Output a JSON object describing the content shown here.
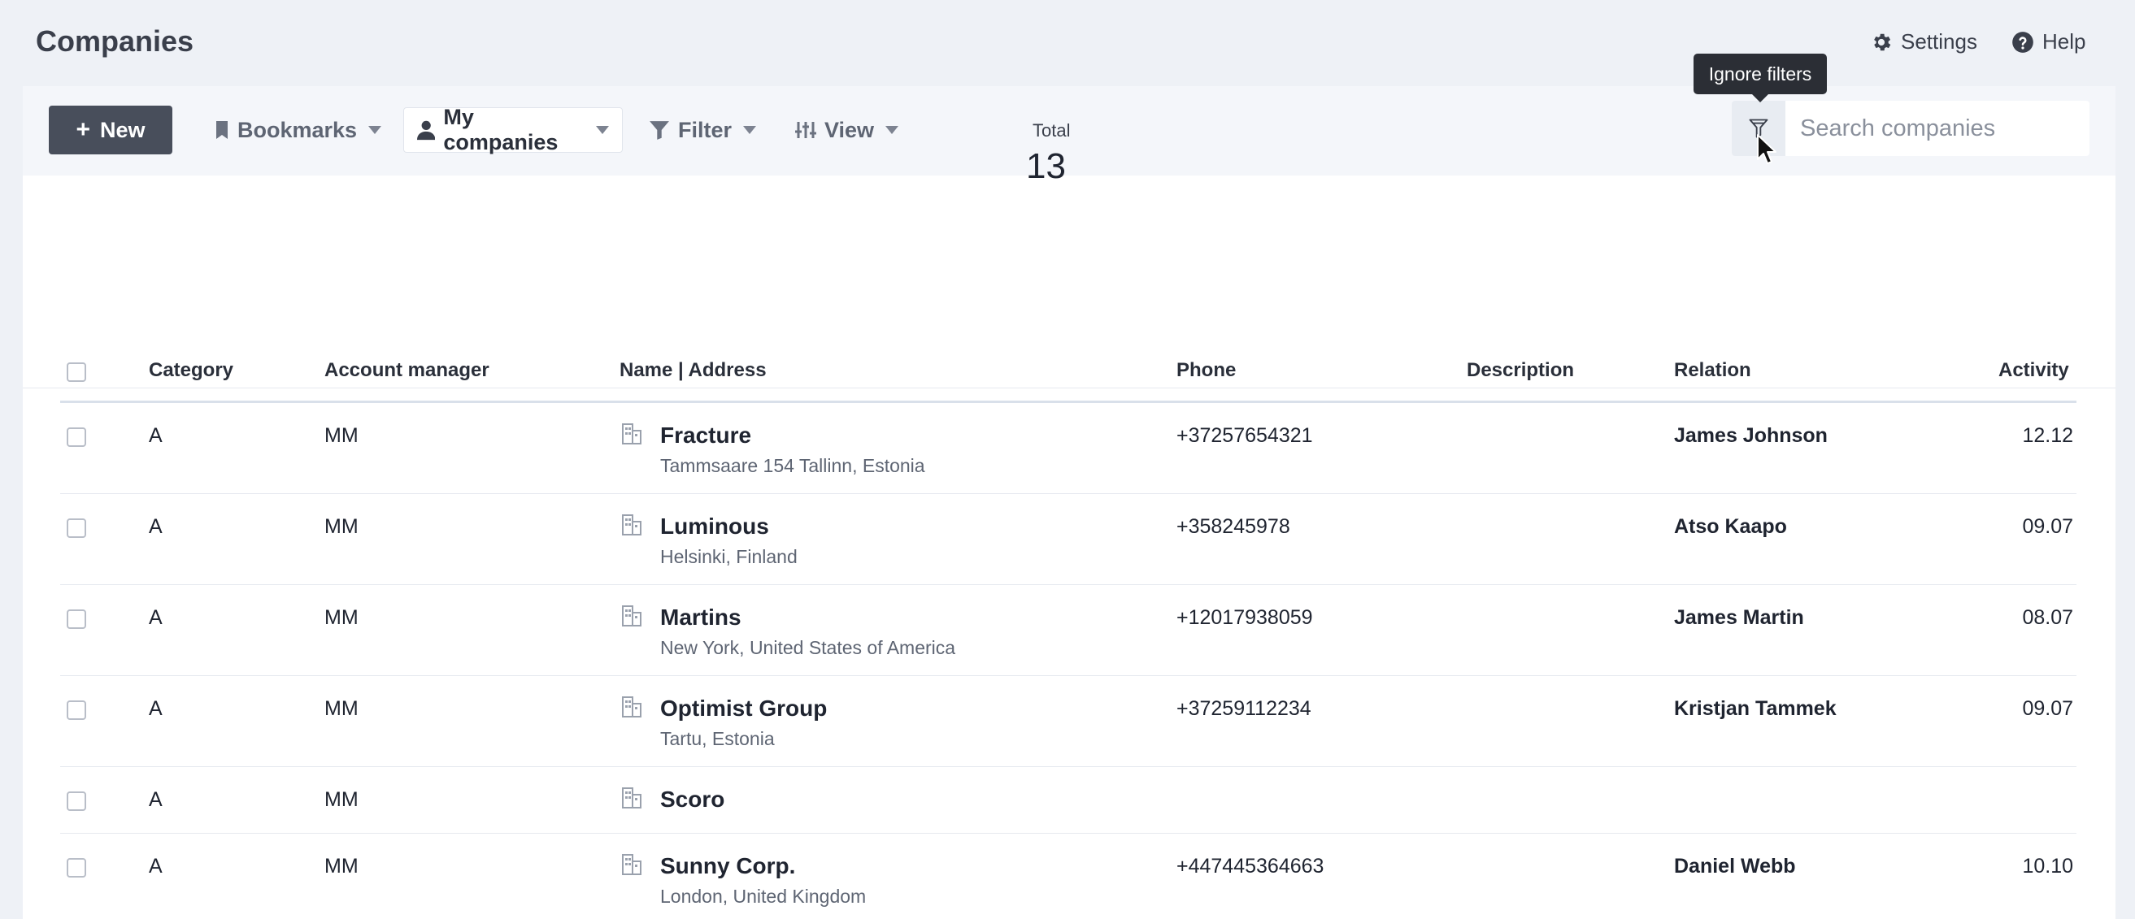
{
  "header": {
    "title": "Companies",
    "settings_label": "Settings",
    "help_label": "Help"
  },
  "toolbar": {
    "new_label": "New",
    "bookmarks_label": "Bookmarks",
    "my_companies_label": "My companies",
    "filter_label": "Filter",
    "view_label": "View"
  },
  "search": {
    "placeholder": "Search companies",
    "value": "",
    "tooltip": "Ignore filters"
  },
  "summary": {
    "total_label": "Total",
    "total_value": "13"
  },
  "table": {
    "columns": {
      "category": "Category",
      "account_manager": "Account manager",
      "name_address": "Name | Address",
      "phone": "Phone",
      "description": "Description",
      "relation": "Relation",
      "activity": "Activity"
    },
    "rows": [
      {
        "category": "A",
        "manager": "MM",
        "name": "Fracture",
        "address": "Tammsaare 154 Tallinn, Estonia",
        "phone": "+37257654321",
        "description": "",
        "relation": "James Johnson",
        "activity": "12.12"
      },
      {
        "category": "A",
        "manager": "MM",
        "name": "Luminous",
        "address": "Helsinki, Finland",
        "phone": "+358245978",
        "description": "",
        "relation": "Atso Kaapo",
        "activity": "09.07"
      },
      {
        "category": "A",
        "manager": "MM",
        "name": "Martins",
        "address": "New York, United States of America",
        "phone": "+12017938059",
        "description": "",
        "relation": "James Martin",
        "activity": "08.07"
      },
      {
        "category": "A",
        "manager": "MM",
        "name": "Optimist Group",
        "address": "Tartu, Estonia",
        "phone": "+37259112234",
        "description": "",
        "relation": "Kristjan Tammek",
        "activity": "09.07"
      },
      {
        "category": "A",
        "manager": "MM",
        "name": "Scoro",
        "address": "",
        "phone": "",
        "description": "",
        "relation": "",
        "activity": ""
      },
      {
        "category": "A",
        "manager": "MM",
        "name": "Sunny Corp.",
        "address": "London, United Kingdom",
        "phone": "+447445364663",
        "description": "",
        "relation": "Daniel Webb",
        "activity": "10.10"
      }
    ]
  },
  "colors": {
    "background": "#eef1f6",
    "primary_button": "#484e5b",
    "tooltip": "#2b2e35"
  },
  "icons": [
    "gear-icon",
    "help-circle-icon",
    "plus-icon",
    "bookmark-icon",
    "person-icon",
    "filter-icon",
    "sliders-icon",
    "ignore-filter-icon",
    "building-icon",
    "mouse-cursor-icon"
  ]
}
